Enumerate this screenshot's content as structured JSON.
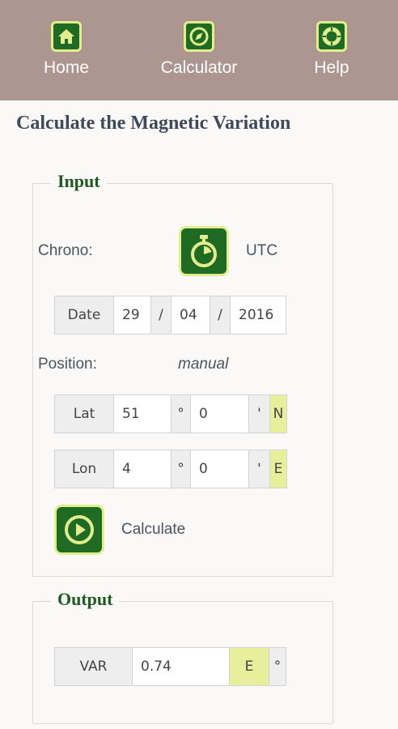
{
  "nav": {
    "items": [
      {
        "label": "Home",
        "icon": "home-icon"
      },
      {
        "label": "Calculator",
        "icon": "compass-icon"
      },
      {
        "label": "Help",
        "icon": "lifebuoy-icon"
      }
    ]
  },
  "page": {
    "title": "Calculate the Magnetic Variation"
  },
  "input": {
    "legend": "Input",
    "chrono_label": "Chrono:",
    "chrono_value": "UTC",
    "date": {
      "label": "Date",
      "day": "29",
      "sep1": "/",
      "month": "04",
      "sep2": "/",
      "year": "2016"
    },
    "position_label": "Position:",
    "position_mode": "manual",
    "lat": {
      "label": "Lat",
      "deg": "51",
      "deg_symbol": "°",
      "min": "0",
      "min_symbol": "'",
      "hemisphere": "N"
    },
    "lon": {
      "label": "Lon",
      "deg": "4",
      "deg_symbol": "°",
      "min": "0",
      "min_symbol": "'",
      "hemisphere": "E"
    },
    "calculate_label": "Calculate"
  },
  "output": {
    "legend": "Output",
    "var": {
      "label": "VAR",
      "value": "0.74",
      "direction": "E",
      "unit": "°"
    }
  },
  "colors": {
    "nav_bg": "#ae9690",
    "accent_green": "#1f6b23",
    "highlight": "#e7ef9a",
    "legend_text": "#1f5a1f"
  }
}
